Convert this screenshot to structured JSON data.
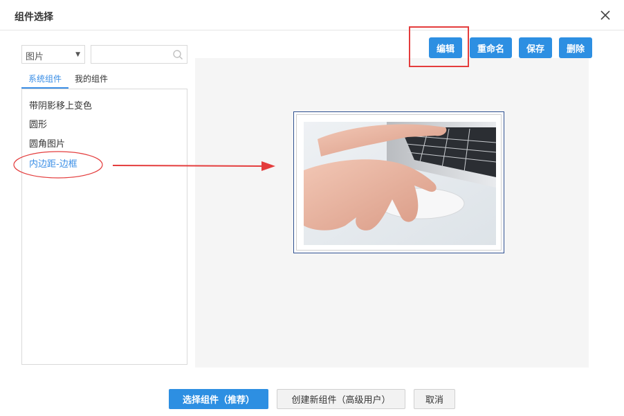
{
  "dialog": {
    "title": "组件选择"
  },
  "filter": {
    "type_value": "图片",
    "search_value": "",
    "search_placeholder": ""
  },
  "tabs": [
    {
      "label": "系统组件",
      "active": true
    },
    {
      "label": "我的组件",
      "active": false
    }
  ],
  "components": [
    {
      "label": "带阴影移上变色"
    },
    {
      "label": "圆形"
    },
    {
      "label": "圆角图片"
    },
    {
      "label": "内边距-边框",
      "selected": true
    }
  ],
  "toolbar": {
    "edit_label": "编辑",
    "rename_label": "重命名",
    "save_label": "保存",
    "delete_label": "删除"
  },
  "footer": {
    "select_label": "选择组件（推荐）",
    "create_label": "创建新组件（高级用户）",
    "cancel_label": "取消"
  },
  "colors": {
    "accent": "#2d8fe2",
    "link": "#3a8ee6",
    "annotation": "#e43c3c"
  },
  "icons": {
    "close": "close-icon",
    "search": "search-icon",
    "dropdown": "caret-down-icon"
  }
}
